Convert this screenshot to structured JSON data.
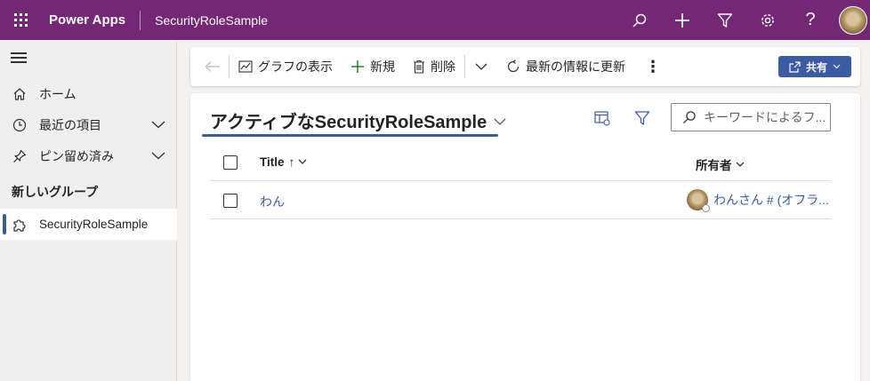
{
  "topbar": {
    "app_name": "Power Apps",
    "app_title": "SecurityRoleSample",
    "icons": [
      "waffle-icon",
      "search-icon",
      "plus-icon",
      "filter-icon",
      "gear-icon",
      "help-icon"
    ],
    "help_label": "?"
  },
  "sidebar": {
    "items": [
      {
        "label": "ホーム",
        "icon": "home-icon"
      },
      {
        "label": "最近の項目",
        "icon": "clock-icon"
      },
      {
        "label": "ピン留め済み",
        "icon": "pin-icon"
      }
    ],
    "group_title": "新しいグループ",
    "active_item": {
      "label": "SecurityRoleSample",
      "icon": "puzzle-icon"
    }
  },
  "commandbar": {
    "chart_label": "グラフの表示",
    "new_label": "新規",
    "delete_label": "削除",
    "refresh_label": "最新の情報に更新",
    "more_label": "⋮",
    "share_label": "共有"
  },
  "view": {
    "title": "アクティブなSecurityRoleSample",
    "search_placeholder": "キーワードによるフ..."
  },
  "grid": {
    "columns": {
      "title": "Title",
      "sort_indicator": "↑",
      "owner": "所有者"
    },
    "rows": [
      {
        "title": "わん",
        "owner": "わんさん # (オフラ..."
      }
    ]
  },
  "colors": {
    "topbar": "#742774",
    "accent": "#3b5ba5",
    "sidebar": "#efefef"
  }
}
